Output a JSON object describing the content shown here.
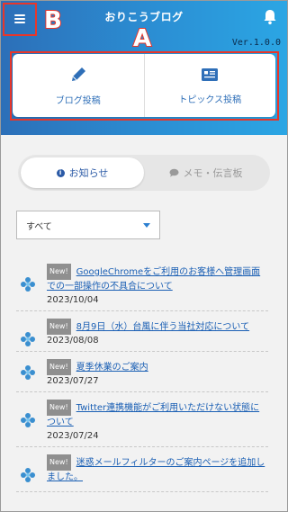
{
  "header": {
    "title": "おりこうブログ",
    "version": "Ver.1.0.0",
    "bg_color": "#2b8fd4"
  },
  "post_actions": {
    "blog_post": {
      "label": "ブログ投稿",
      "icon": "pen-icon"
    },
    "topics_post": {
      "label": "トピックス投稿",
      "icon": "newspaper-icon"
    }
  },
  "annotations": {
    "a": "A",
    "b": "B",
    "color": "#e8362a"
  },
  "tabs": [
    {
      "label": "お知らせ",
      "icon": "info-icon",
      "active": true
    },
    {
      "label": "メモ・伝言板",
      "icon": "chat-icon",
      "active": false
    }
  ],
  "filter": {
    "selected": "すべて"
  },
  "news": [
    {
      "badge": "New!",
      "title": "GoogleChromeをご利用のお客様へ管理画面での一部操作の不具合について",
      "date": "2023/10/04"
    },
    {
      "badge": "New!",
      "title": "8月9日（水）台風に伴う当社対応について",
      "date": "2023/08/08"
    },
    {
      "badge": "New!",
      "title": "夏季休業のご案内",
      "date": "2023/07/27"
    },
    {
      "badge": "New!",
      "title": "Twitter連携機能がご利用いただけない状態について",
      "date": "2023/07/24"
    },
    {
      "badge": "New!",
      "title": "迷惑メールフィルターのご案内ページを追加しました。",
      "date": ""
    }
  ]
}
